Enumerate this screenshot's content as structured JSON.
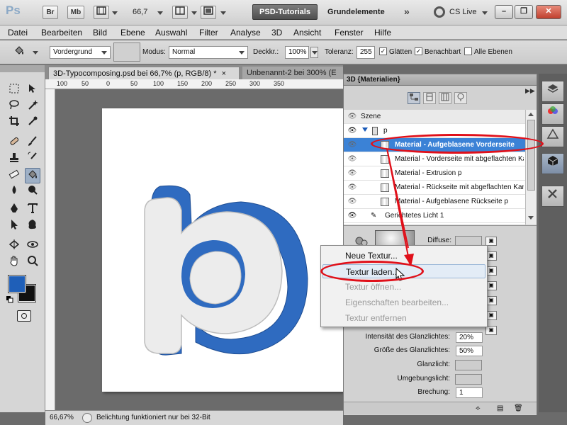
{
  "appbar": {
    "logo": "Ps",
    "bridge_label": "Br",
    "minibridge_label": "Mb",
    "zoom": "66,7",
    "workspace_button": "PSD-Tutorials",
    "workspace_name": "Grundelemente",
    "more": "»",
    "cs_live": "CS Live",
    "win_min": "–",
    "win_max": "❐",
    "win_close": "✕"
  },
  "menu": [
    "Datei",
    "Bearbeiten",
    "Bild",
    "Ebene",
    "Auswahl",
    "Filter",
    "Analyse",
    "3D",
    "Ansicht",
    "Fenster",
    "Hilfe"
  ],
  "options": {
    "fill_source": "Vordergrund",
    "mode_label": "Modus:",
    "mode_value": "Normal",
    "opacity_label": "Deckkr.:",
    "opacity_value": "100%",
    "tolerance_label": "Toleranz:",
    "tolerance_value": "255",
    "smooth_label": "Glätten",
    "contiguous_label": "Benachbart",
    "all_layers_label": "Alle Ebenen",
    "smooth_checked": true,
    "contiguous_checked": true,
    "all_layers_checked": false
  },
  "tools": [
    "move",
    "marquee",
    "lasso",
    "quick-select",
    "crop",
    "eyedropper",
    "healing",
    "brush",
    "clone-stamp",
    "history-brush",
    "eraser",
    "paint-bucket",
    "blur",
    "dodge",
    "pen",
    "type",
    "path-select",
    "shape",
    "3d-rotate",
    "3d-orbit",
    "hand",
    "zoom"
  ],
  "colors": {
    "foreground": "#1f5fb8",
    "background": "#111111",
    "letter_face": "#ececec",
    "letter_side": "#2f6bc0",
    "accent": "#3b82d6",
    "highlight": "#e0101a"
  },
  "document": {
    "tab1": "3D-Typocomposing.psd bei 66,7% (p, RGB/8) *",
    "tab1_close": "×",
    "tab2": "Unbenannt-2 bei 300% (E",
    "ruler_ticks": [
      "100",
      "50",
      "0",
      "50",
      "100",
      "150",
      "200",
      "250",
      "300",
      "350"
    ],
    "zoom_status": "66,67%",
    "status_text": "Belichtung funktioniert nur bei 32-Bit"
  },
  "panel3d": {
    "title": "3D {Materialien}",
    "scene_label": "Szene",
    "object_label": "p",
    "rows": [
      "Material - Aufgeblasene Vorderseite",
      "Material - Vorderseite mit abgeflachten Kanten",
      "Material - Extrusion p",
      "Material - Rückseite mit abgeflachten Kanten",
      "Material - Aufgeblasene Rückseite p"
    ],
    "light_label": "Gerichtetes Licht 1",
    "diffuse_label": "Diffuse:",
    "gloss_intensity_label": "Intensität des Glanzlichtes:",
    "gloss_intensity_value": "20%",
    "gloss_size_label": "Größe des Glanzlichtes:",
    "gloss_size_value": "50%",
    "shine_label": "Glanzlicht:",
    "ambient_label": "Umgebungslicht:",
    "refraction_label": "Brechung:",
    "refraction_value": "1"
  },
  "context_menu": {
    "items": [
      "Neue Textur...",
      "Textur laden...",
      "Textur öffnen...",
      "Eigenschaften bearbeiten...",
      "Textur entfernen"
    ],
    "hover_index": 1
  }
}
